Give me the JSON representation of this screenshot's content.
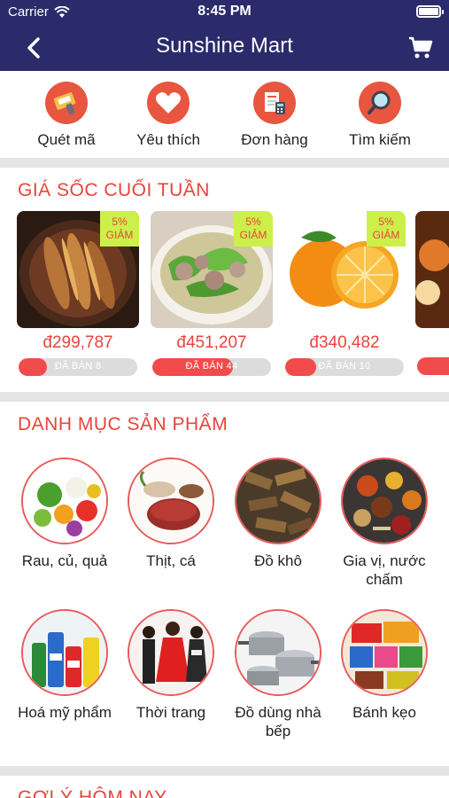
{
  "status_bar": {
    "carrier": "Carrier",
    "time": "8:45 PM"
  },
  "nav": {
    "title": "Sunshine Mart"
  },
  "quick_actions": [
    {
      "label": "Quét mã",
      "icon": "barcode-scanner-icon"
    },
    {
      "label": "Yêu thích",
      "icon": "heart-icon"
    },
    {
      "label": "Đơn hàng",
      "icon": "receipt-calculator-icon"
    },
    {
      "label": "Tìm kiếm",
      "icon": "magnifier-icon"
    }
  ],
  "flash_sale": {
    "title": "GIÁ SỐC CUỐI TUẦN",
    "items": [
      {
        "discount": "5%",
        "discount_label": "GIẢM",
        "price": "đ299,787",
        "sold": "ĐÃ BÁN 8",
        "sold_ratio": 0.24,
        "image": "braised-fish-pot"
      },
      {
        "discount": "5%",
        "discount_label": "GIẢM",
        "price": "đ451,207",
        "sold": "ĐÃ BÁN 44",
        "sold_ratio": 0.68,
        "image": "meatball-vegetable-soup"
      },
      {
        "discount": "5%",
        "discount_label": "GIẢM",
        "price": "đ340,482",
        "sold": "ĐÃ BÁN 10",
        "sold_ratio": 0.26,
        "image": "oranges"
      }
    ]
  },
  "categories": {
    "title": "DANH MỤC SẢN PHẨM",
    "items": [
      {
        "name": "Rau, củ, quả",
        "image": "vegetables"
      },
      {
        "name": "Thịt, cá",
        "image": "meat-fish"
      },
      {
        "name": "Đồ khô",
        "image": "dried-food"
      },
      {
        "name": "Gia vị, nước chấm",
        "image": "spices"
      },
      {
        "name": "Hoá mỹ phẩm",
        "image": "detergents"
      },
      {
        "name": "Thời trang",
        "image": "fashion"
      },
      {
        "name": "Đồ dùng nhà bếp",
        "image": "cookware"
      },
      {
        "name": "Bánh kẹo",
        "image": "snacks"
      }
    ]
  },
  "suggestions": {
    "title": "GỢI Ý HÔM NAY"
  },
  "colors": {
    "header": "#2b2a6b",
    "accent": "#e8443c",
    "badge": "#ccf04a",
    "divider": "#e4e4e4"
  }
}
